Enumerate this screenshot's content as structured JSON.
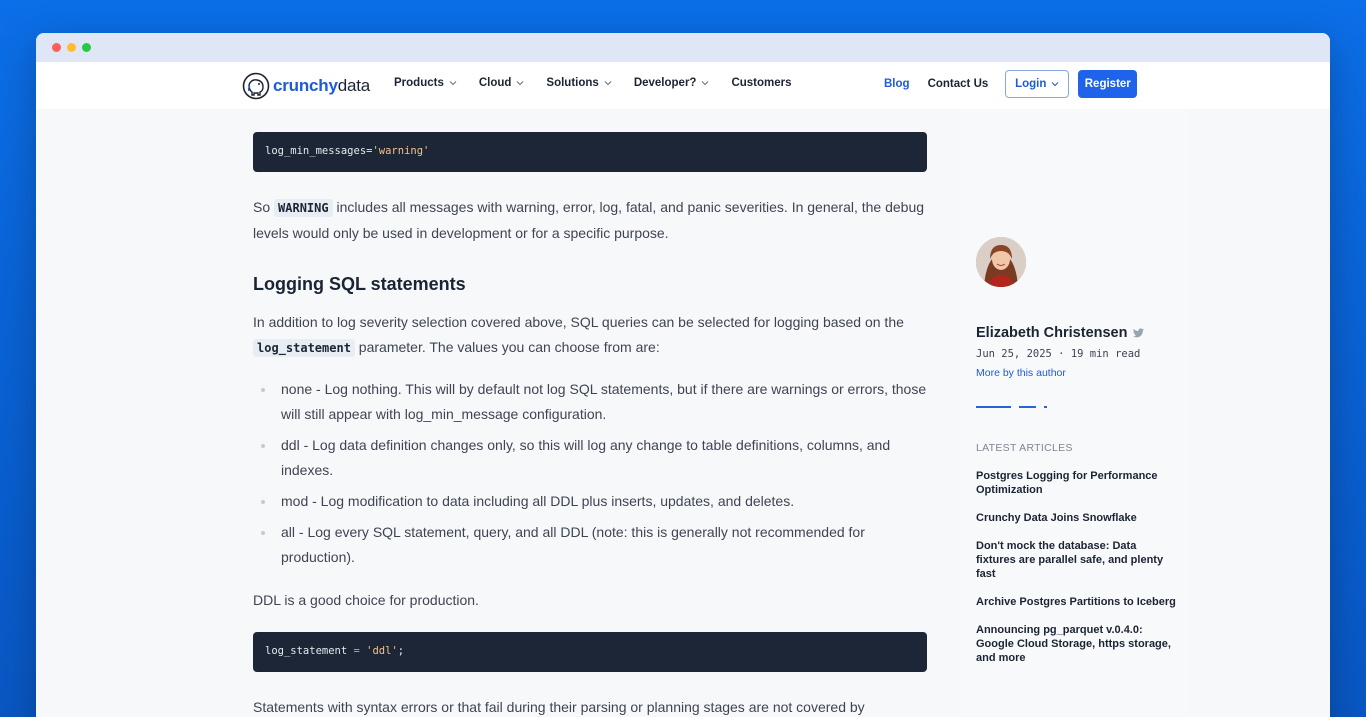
{
  "window": {
    "controls": [
      "close",
      "minimize",
      "maximize"
    ]
  },
  "nav": {
    "logo_word1": "crunchy",
    "logo_word2": "data",
    "items": [
      {
        "label": "Products"
      },
      {
        "label": "Cloud"
      },
      {
        "label": "Solutions"
      },
      {
        "label": "Developer?"
      },
      {
        "label": "Customers"
      }
    ],
    "blog": "Blog",
    "contact": "Contact Us",
    "login": "Login",
    "register": "Register"
  },
  "article": {
    "code1": {
      "key": "log_min_messages=",
      "value": "'warning'"
    },
    "para1": {
      "pre": "So ",
      "code": "WARNING",
      "post": " includes all messages with warning, error, log, fatal, and panic severities. In general, the debug levels would only be used in development or for a specific purpose."
    },
    "heading": "Logging SQL statements",
    "para2": {
      "pre": "In addition to log severity selection covered above, SQL queries can be selected for logging based on the ",
      "code": "log_statement",
      "post": " parameter. The values you can choose from are:"
    },
    "bullets": [
      "none - Log nothing. This will by default not log SQL statements, but if there are warnings or errors, those will still appear with log_min_message configuration.",
      "ddl - Log data definition changes only, so this will log any change to table definitions, columns, and indexes.",
      "mod - Log modification to data including all DDL plus inserts, updates, and deletes.",
      "all - Log every SQL statement, query, and all DDL (note: this is generally not recommended for production)."
    ],
    "para3": "DDL is a good choice for production.",
    "code2": {
      "key": "log_statement",
      "op": " = ",
      "value": "'ddl'",
      "end": ";"
    },
    "para4": "Statements with syntax errors or that fail during their parsing or planning stages are not covered by"
  },
  "sidebar": {
    "author_name": "Elizabeth Christensen",
    "meta": "Jun 25, 2025 · 19 min read",
    "more_by_author": "More by this author",
    "latest_title": "LATEST ARTICLES",
    "latest_articles": [
      "Postgres Logging for Performance Optimization",
      "Crunchy Data Joins Snowflake",
      "Don't mock the database: Data fixtures are parallel safe, and plenty fast",
      "Archive Postgres Partitions to Iceberg",
      "Announcing pg_parquet v.0.4.0: Google Cloud Storage, https storage, and more"
    ]
  },
  "colors": {
    "brand": "#1e5bd8",
    "background_gradient": "#0b6fe8",
    "code_bg": "#1c2637"
  }
}
